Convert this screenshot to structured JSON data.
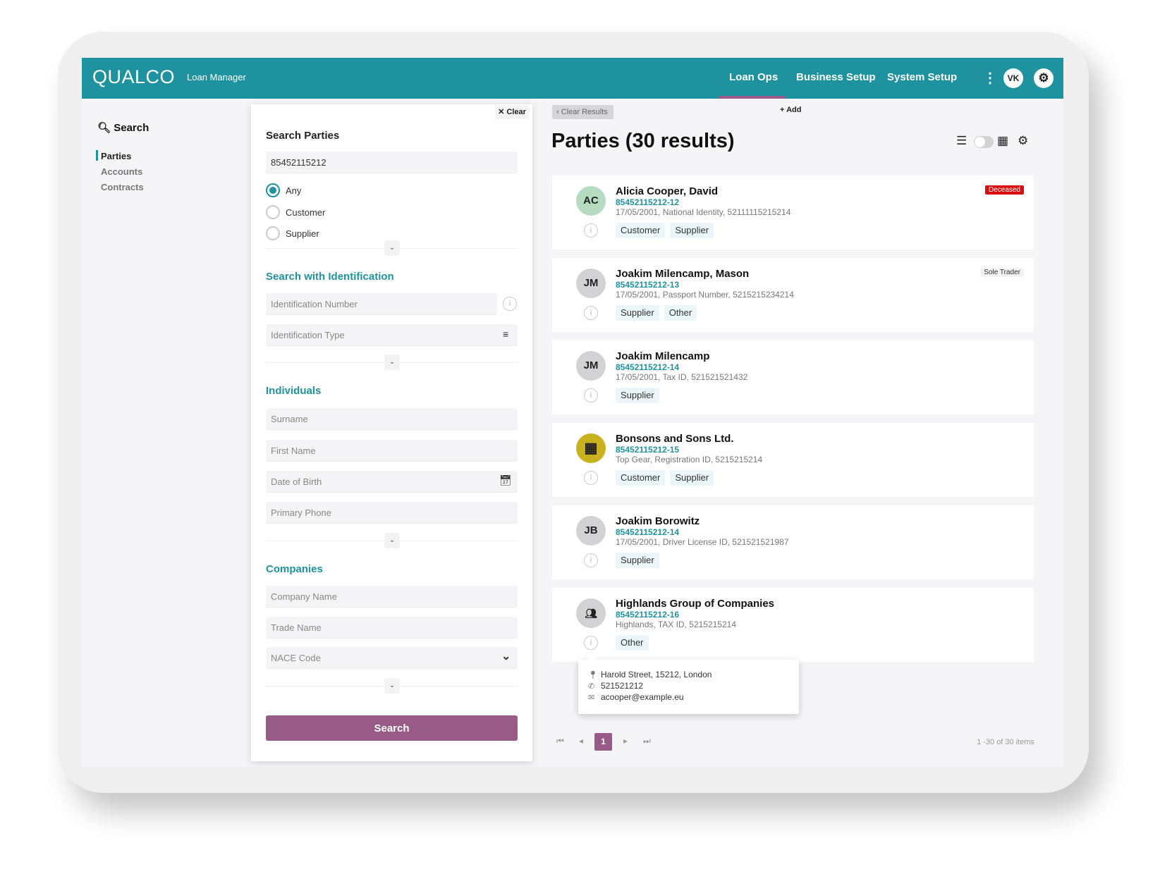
{
  "header": {
    "logo": "QUALCO",
    "app_name": "Loan Manager",
    "nav": [
      "Loan Ops",
      "Business Setup",
      "System Setup"
    ],
    "active_nav": "Loan Ops",
    "user_initials": "VK",
    "accent": "#1e939f",
    "highlight": "#985a87"
  },
  "left_nav": {
    "title": "Search",
    "items": [
      "Parties",
      "Accounts",
      "Contracts"
    ],
    "active": "Parties"
  },
  "form": {
    "clear_label": "Clear",
    "title": "Search Parties",
    "search_value": "85452115212",
    "radios": [
      {
        "label": "Any",
        "checked": true
      },
      {
        "label": "Customer",
        "checked": false
      },
      {
        "label": "Supplier",
        "checked": false
      }
    ],
    "identification": {
      "title": "Search with Identification",
      "number_placeholder": "Identification Number",
      "type_placeholder": "Identification Type"
    },
    "individuals": {
      "title": "Individuals",
      "surname": "Surname",
      "first_name": "First Name",
      "dob": "Date of Birth",
      "phone": "Primary Phone"
    },
    "companies": {
      "title": "Companies",
      "company_name": "Company Name",
      "trade_name": "Trade Name",
      "nace": "NACE Code"
    },
    "search_button": "Search"
  },
  "results": {
    "clear_results": "Clear Results",
    "add": "Add",
    "title": "Parties (30 results)",
    "cards": [
      {
        "initials": "AC",
        "avatar_color": "#b5dcc0",
        "name": "Alicia Cooper, David",
        "id": "85452115212-12",
        "detail": "17/05/2001, National Identity, 52111115215214",
        "tags": [
          "Customer",
          "Supplier"
        ],
        "badge": "Deceased",
        "badge_style": "red"
      },
      {
        "initials": "JM",
        "avatar_color": "#d2d2d4",
        "name": "Joakim Milencamp, Mason",
        "id": "85452115212-13",
        "detail": "17/05/2001, Passport Number, 5215215234214",
        "tags": [
          "Supplier",
          "Other"
        ],
        "badge": "Sole Trader",
        "badge_style": "gray"
      },
      {
        "initials": "JM",
        "avatar_color": "#d2d2d4",
        "name": "Joakim  Milencamp",
        "id": "85452115212-14",
        "detail": "17/05/2001, Tax ID, 521521521432",
        "tags": [
          "Supplier"
        ]
      },
      {
        "icon": "building-icon",
        "avatar_color": "#c9b21f",
        "name": "Bonsons and Sons Ltd.",
        "id": "85452115212-15",
        "detail": "Top Gear, Registration ID, 5215215214",
        "tags": [
          "Customer",
          "Supplier"
        ]
      },
      {
        "initials": "JB",
        "avatar_color": "#d2d2d4",
        "name": "Joakim  Borowitz",
        "id": "85452115212-14",
        "detail": "17/05/2001, Driver License ID, 521521521987",
        "tags": [
          "Supplier"
        ]
      },
      {
        "icon": "group-icon",
        "avatar_color": "#d2d2d4",
        "name": "Highlands Group of Companies",
        "id": "85452115212-16",
        "detail": "Highlands, TAX ID, 5215215214",
        "tags": [
          "Other"
        ]
      }
    ],
    "tooltip": {
      "address": "Harold Street, 15212, London",
      "phone": "521521212",
      "email": "acooper@example.eu"
    },
    "pagination": {
      "current_page": "1",
      "summary": "1 -30 of 30 items"
    }
  }
}
